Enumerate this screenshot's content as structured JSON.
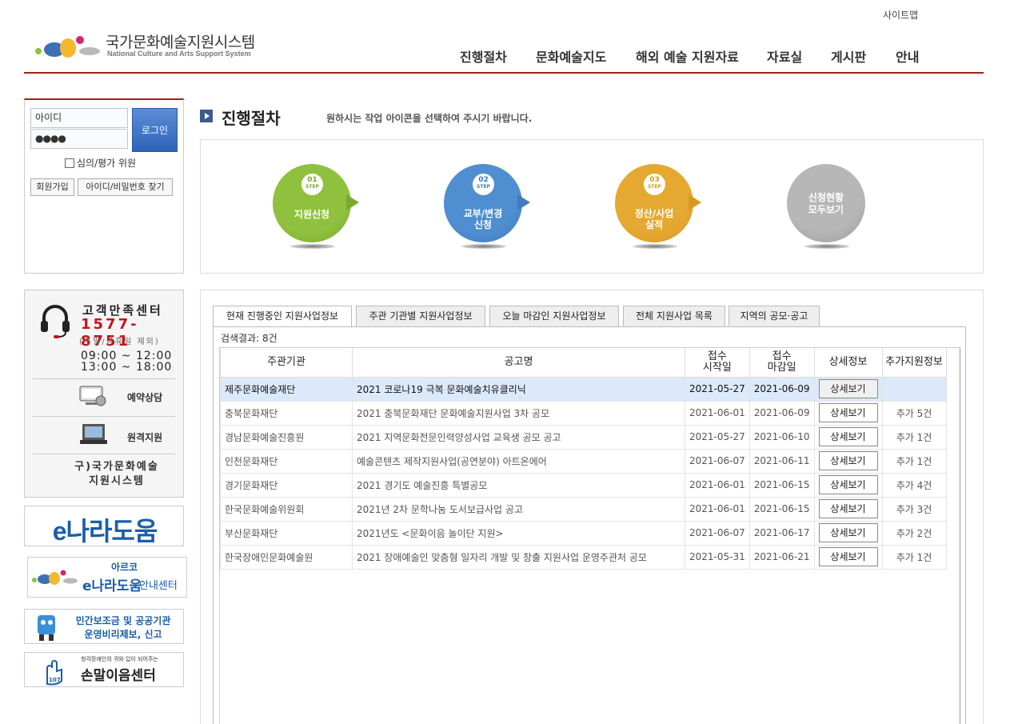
{
  "header": {
    "sitemap": "사이트맵",
    "logo_title": "국가문화예술지원시스템",
    "logo_sub": "National Culture and Arts Support System",
    "nav": [
      "진행절차",
      "문화예술지도",
      "해외 예술 지원자료",
      "자료실",
      "게시판",
      "안내"
    ]
  },
  "login": {
    "id_value": "아이디",
    "pw_value": "●●●●",
    "login_button": "로그인",
    "reviewer_checkbox": "심의/평가 위원",
    "signup_button": "회원가입",
    "find_button": "아이디/비밀번호 찾기"
  },
  "customer_center": {
    "title": "고객만족센터",
    "phone": "1577-8751",
    "note": "(주말/공휴일 제외)",
    "time1": "09:00 ~ 12:00",
    "time2": "13:00 ~ 18:00",
    "reservation": "예약상담",
    "remote": "원격지원",
    "old_system_line1": "구)국가문화예술",
    "old_system_line2": "지원시스템"
  },
  "banners": {
    "enara": "e나라도움",
    "arko_top": "아르코",
    "arko_main": "e나라도움",
    "arko_suffix": "안내센터",
    "report_line1": "민간보조금 및 공공기관",
    "report_line2": "운영비리제보, 신고",
    "sign_small": "청각장애인의 귀와 입이 되어주는",
    "sign_main": "손말이음센터"
  },
  "main": {
    "title": "진행절차",
    "description": "원하시는 작업 아이콘을 선택하여 주시기 바랍니다.",
    "steps": [
      {
        "num": "01",
        "step": "STEP",
        "label1": "지원신청",
        "label2": "",
        "color": "#8fc13f",
        "num_color": "#7aa92e"
      },
      {
        "num": "02",
        "step": "STEP",
        "label1": "교부/변경",
        "label2": "신청",
        "color": "#4f8ed0",
        "num_color": "#3f7bbd"
      },
      {
        "num": "03",
        "step": "STEP",
        "label1": "정산/사업",
        "label2": "실적",
        "color": "#e5a932",
        "num_color": "#d89a1f"
      },
      {
        "num": "",
        "step": "",
        "label1": "신청현황",
        "label2": "모두보기",
        "color": "#b7b7b7",
        "num_color": "#999999"
      }
    ]
  },
  "tabs": [
    "현재 진행중인 지원사업정보",
    "주관 기관별 지원사업정보",
    "오늘 마감인 지원사업정보",
    "전체 지원사업 목록",
    "지역의 공모·공고"
  ],
  "result_count": "검색결과: 8건",
  "table": {
    "headers": [
      "주관기관",
      "공고명",
      "접수\n시작일",
      "접수\n마감일",
      "상세정보",
      "추가지원정보"
    ],
    "detail_label": "상세보기",
    "rows": [
      {
        "org": "제주문화예술재단",
        "title": "2021 코로나19 극복 문화예술치유클리닉",
        "start": "2021-05-27",
        "end": "2021-06-09",
        "extra": ""
      },
      {
        "org": "충북문화재단",
        "title": "2021 충북문화재단 문화예술지원사업 3차 공모",
        "start": "2021-06-01",
        "end": "2021-06-09",
        "extra": "추가 5건"
      },
      {
        "org": "경남문화예술진흥원",
        "title": "2021 지역문화전문인력양성사업 교육생 공모 공고",
        "start": "2021-05-27",
        "end": "2021-06-10",
        "extra": "추가 1건"
      },
      {
        "org": "인천문화재단",
        "title": "예술콘텐츠 제작지원사업(공연분야) 아트온에어",
        "start": "2021-06-07",
        "end": "2021-06-11",
        "extra": "추가 1건"
      },
      {
        "org": "경기문화재단",
        "title": "2021 경기도 예술진흥 특별공모",
        "start": "2021-06-01",
        "end": "2021-06-15",
        "extra": "추가 4건"
      },
      {
        "org": "한국문화예술위원회",
        "title": "2021년 2차 문학나눔 도서보급사업 공고",
        "start": "2021-06-01",
        "end": "2021-06-15",
        "extra": "추가 3건"
      },
      {
        "org": "부산문화재단",
        "title": "2021년도 <문화이음 놀이단 지원>",
        "start": "2021-06-07",
        "end": "2021-06-17",
        "extra": "추가 2건"
      },
      {
        "org": "한국장애인문화예술원",
        "title": "2021 장애예술인 맞춤형 일자리 개발 및 창출 지원사업 운영주관처 공모",
        "start": "2021-05-31",
        "end": "2021-06-21",
        "extra": "추가 1건"
      }
    ]
  },
  "colors": {
    "accent": "#a3201e",
    "selected_row": "#dce9fb"
  }
}
